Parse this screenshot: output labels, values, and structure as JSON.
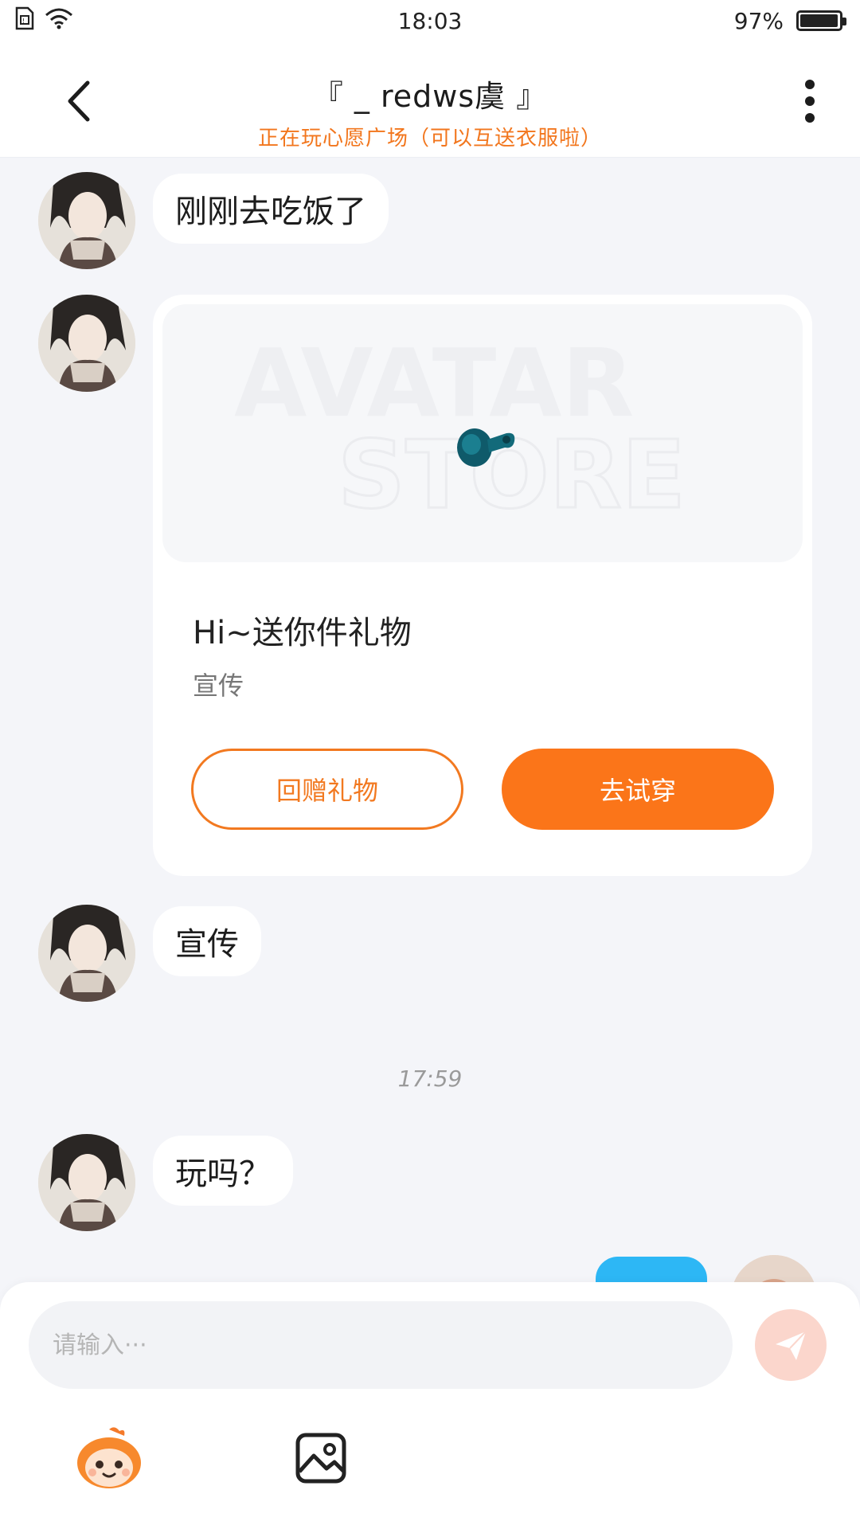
{
  "status_bar": {
    "time": "18:03",
    "battery_text": "97%",
    "battery_level": 0.97
  },
  "header": {
    "title": "『 _ redws虞 』",
    "subtitle": "正在玩心愿广场（可以互送衣服啦）"
  },
  "messages": [
    {
      "from": "them",
      "text": "刚刚去吃饭了"
    },
    {
      "from": "them",
      "type": "gift_card",
      "banner_text": [
        "AVATAR",
        "STORE"
      ],
      "title": "Hi~送你件礼物",
      "subtitle": "宣传",
      "secondary_button": "回赠礼物",
      "primary_button": "去试穿"
    },
    {
      "from": "them",
      "text": "宣传"
    },
    {
      "type": "timestamp",
      "text": "17:59"
    },
    {
      "from": "them",
      "text": "玩吗？"
    },
    {
      "from": "me",
      "text": ""
    }
  ],
  "composer": {
    "placeholder": "请输入···",
    "value": ""
  },
  "colors": {
    "accent_orange": "#fb7519",
    "my_bubble_blue": "#2db7f5",
    "send_disabled": "#fbd6cc",
    "background": "#f4f5f9"
  },
  "icons": {
    "back": "chevron-left-icon",
    "more": "vertical-dots-icon",
    "send": "paper-plane-icon",
    "emoji": "mascot-face-icon",
    "image": "image-icon",
    "gift_item": "pacifier-icon"
  }
}
